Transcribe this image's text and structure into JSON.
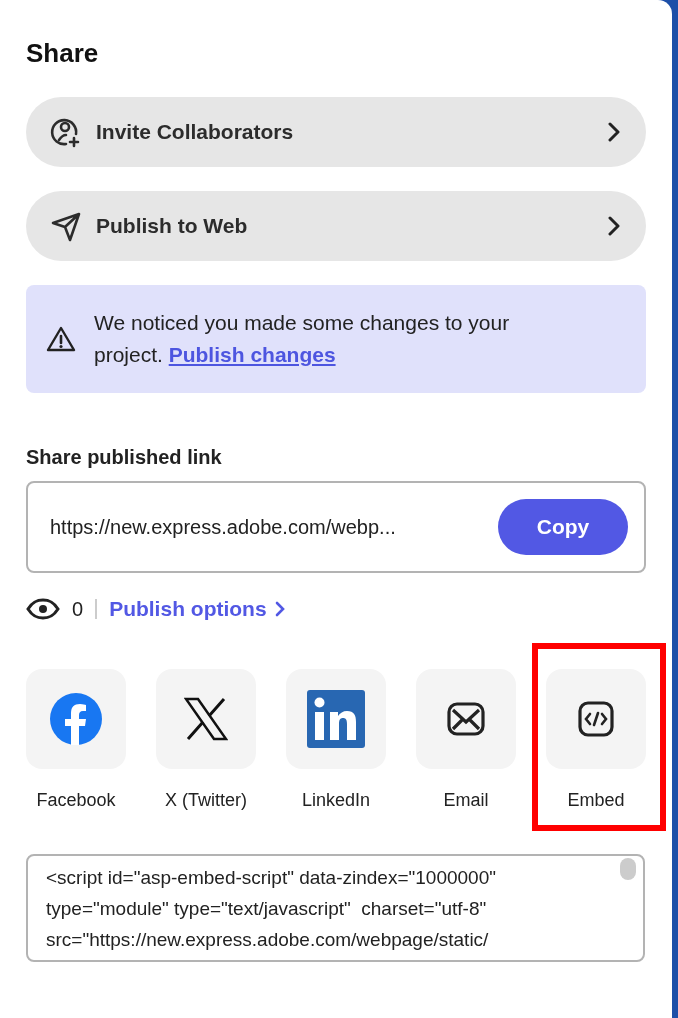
{
  "title": "Share",
  "actions": [
    {
      "label": "Invite Collaborators",
      "kind": "invite"
    },
    {
      "label": "Publish to Web",
      "kind": "publish"
    }
  ],
  "notice": {
    "text": "We noticed you made some changes to your project.",
    "link": "Publish changes"
  },
  "link_section": {
    "heading": "Share published link",
    "url": "https://new.express.adobe.com/webp...",
    "button": "Copy"
  },
  "stats": {
    "views": "0",
    "options_link": "Publish options"
  },
  "share_targets": [
    {
      "label": "Facebook",
      "kind": "facebook",
      "highlighted": false
    },
    {
      "label": "X (Twitter)",
      "kind": "x",
      "highlighted": false
    },
    {
      "label": "LinkedIn",
      "kind": "linkedin",
      "highlighted": false
    },
    {
      "label": "Email",
      "kind": "email",
      "highlighted": false
    },
    {
      "label": "Embed",
      "kind": "embed",
      "highlighted": true
    }
  ],
  "embed_code": "<script id=\"asp-embed-script\" data-zindex=\"1000000\" type=\"module\" type=\"text/javascript\"  charset=\"utf-8\" src=\"https://new.express.adobe.com/webpage/static/"
}
